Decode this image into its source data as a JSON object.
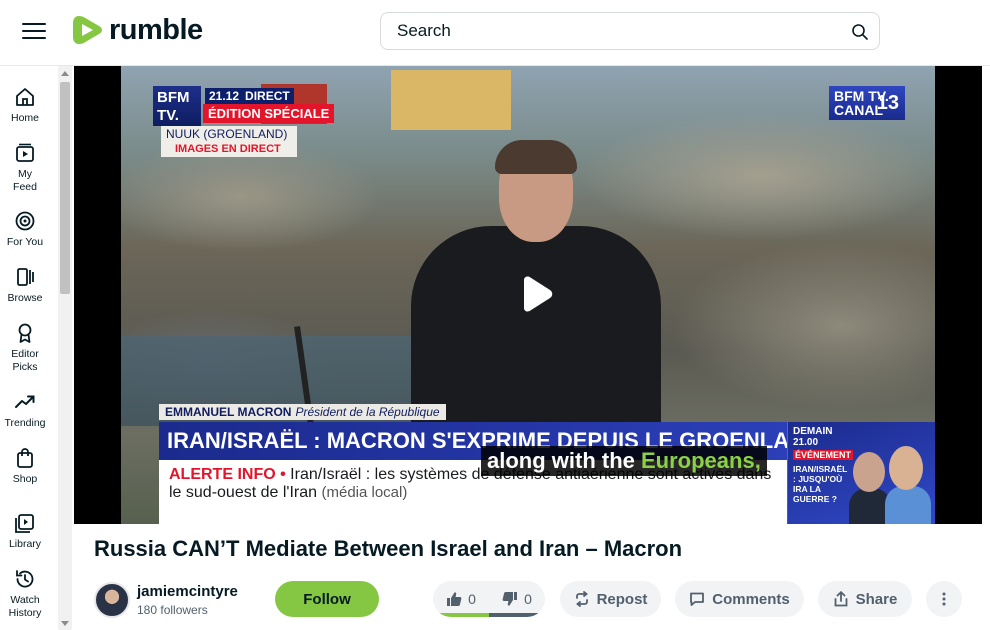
{
  "header": {
    "logo_text": "rumble",
    "search_placeholder": "Search"
  },
  "sidebar": {
    "items": [
      {
        "label": "Home",
        "icon": "home-icon"
      },
      {
        "label": "My Feed",
        "icon": "feed-icon"
      },
      {
        "label": "For You",
        "icon": "target-icon"
      },
      {
        "label": "Browse",
        "icon": "browse-icon"
      },
      {
        "label": "Editor Picks",
        "icon": "award-icon"
      },
      {
        "label": "Trending",
        "icon": "trending-icon"
      },
      {
        "label": "Shop",
        "icon": "bag-icon"
      },
      {
        "label": "Library",
        "icon": "library-icon"
      },
      {
        "label": "Watch History",
        "icon": "history-icon"
      }
    ]
  },
  "player": {
    "overlay": {
      "channel_logo_left": "BFM TV.",
      "time": "21.12",
      "live": "DIRECT",
      "edition": "ÉDITION SPÉCIALE",
      "location": "NUUK (GROENLAND)",
      "images": "IMAGES EN DIRECT",
      "channel_logo_right": "BFM TV. CANAL",
      "channel_number": "13",
      "speaker_name": "EMMANUEL MACRON",
      "speaker_role": "Président de la République",
      "headline": "IRAN/ISRAËL : MACRON S'EXPRIME DEPUIS LE GROENLAND",
      "alert_tag": "ALERTE INFO •",
      "alert_text": "Iran/Israël : les systèmes de défense antiaérienne sont activés dans le sud-ouest de l'Iran",
      "alert_source": "(média local)",
      "promo_line1": "DEMAIN",
      "promo_line2": "21.00",
      "promo_tag": "ÉVÉNEMENT",
      "promo_title": "IRAN/ISRAËL : JUSQU'OÙ IRA LA GUERRE ?"
    },
    "caption_start": "along with the ",
    "caption_highlight": "Europeans,"
  },
  "video": {
    "title": "Russia CAN’T Mediate Between Israel and Iran – Macron",
    "channel_name": "jamiemcintyre",
    "followers": "180 followers",
    "follow_label": "Follow",
    "likes": "0",
    "dislikes": "0",
    "repost_label": "Repost",
    "comments_label": "Comments",
    "share_label": "Share"
  },
  "colors": {
    "brand_green": "#85c742",
    "text_dark": "#061a23",
    "pill_bg": "#f1f3f5"
  }
}
